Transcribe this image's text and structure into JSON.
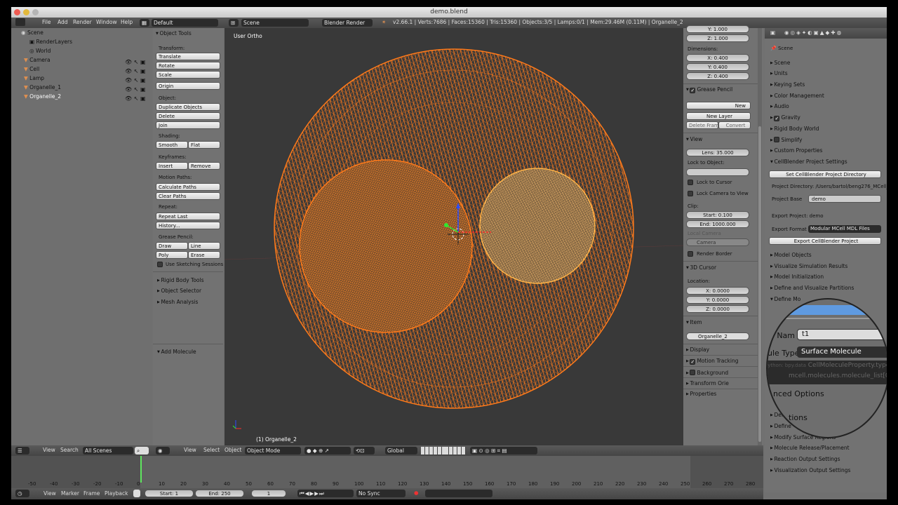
{
  "window": {
    "title": "demo.blend"
  },
  "info_header": {
    "menus": [
      "File",
      "Add",
      "Render",
      "Window",
      "Help"
    ],
    "layout": "Default",
    "scene": "Scene",
    "engine": "Blender Render",
    "stats": "v2.66.1 | Verts:7686 | Faces:15360 | Tris:15360 | Objects:3/5 | Lamps:0/1 | Mem:29.46M (0.11M) | Organelle_2"
  },
  "outliner": {
    "items": [
      "Scene",
      "RenderLayers",
      "World",
      "Camera",
      "Cell",
      "Lamp",
      "Organelle_1",
      "Organelle_2"
    ]
  },
  "tools": {
    "title": "Object Tools",
    "transform_label": "Transform:",
    "translate": "Translate",
    "rotate": "Rotate",
    "scale": "Scale",
    "origin": "Origin",
    "object_label": "Object:",
    "duplicate": "Duplicate Objects",
    "delete": "Delete",
    "join": "Join",
    "shading_label": "Shading:",
    "smooth": "Smooth",
    "flat": "Flat",
    "keyframes_label": "Keyframes:",
    "insert": "Insert",
    "remove": "Remove",
    "motion_label": "Motion Paths:",
    "calc_paths": "Calculate Paths",
    "clear_paths": "Clear Paths",
    "repeat_label": "Repeat:",
    "repeat_last": "Repeat Last",
    "history": "History...",
    "gp_label": "Grease Pencil:",
    "draw": "Draw",
    "line": "Line",
    "poly": "Poly",
    "erase": "Erase",
    "sketch": "Use Sketching Sessions",
    "rigid": "Rigid Body Tools",
    "selector": "Object Selector",
    "mesh_analysis": "Mesh Analysis",
    "add_molecule": "Add Molecule"
  },
  "viewport": {
    "view_name": "User Ortho",
    "object_label": "(1) Organelle_2",
    "colors": {
      "cell": "#ff7a1a",
      "organelle1": "#ff7a1a",
      "organelle2": "#ffb347"
    }
  },
  "view3d_header": {
    "view": "View",
    "select": "Select",
    "object": "Object",
    "mode": "Object Mode",
    "orientation": "Global"
  },
  "npanel": {
    "y": "Y: 1.000",
    "z": "Z: 1.000",
    "dimensions": "Dimensions:",
    "dx": "X: 0.400",
    "dy": "Y: 0.400",
    "dz": "Z: 0.400",
    "grease": "Grease Pencil",
    "new": "New",
    "new_layer": "New Layer",
    "delete_frame": "Delete Frame",
    "convert": "Convert",
    "view": "View",
    "lens": "Lens: 35.000",
    "lock_obj": "Lock to Object:",
    "lock_cursor": "Lock to Cursor",
    "lock_camera": "Lock Camera to View",
    "clip": "Clip:",
    "start": "Start: 0.100",
    "end": "End: 1000.000",
    "local_camera": "Local Camera",
    "camera": "Camera",
    "render_border": "Render Border",
    "cursor3d": "3D Cursor",
    "location": "Location:",
    "cx": "X: 0.0000",
    "cy": "Y: 0.0000",
    "cz": "Z: 0.0000",
    "item": "Item",
    "item_name": "Organelle_2",
    "display": "Display",
    "motion_tracking": "Motion Tracking",
    "background": "Background",
    "transform_orient": "Transform Orie",
    "properties": "Properties"
  },
  "props": {
    "scene_label": "Scene",
    "sections": [
      "Scene",
      "Units",
      "Keying Sets",
      "Color Management",
      "Audio",
      "Gravity",
      "Rigid Body World",
      "Simplify",
      "Custom Properties"
    ],
    "cellblender": "CellBlender Project Settings",
    "set_dir": "Set CellBlender Project Directory",
    "project_dir": "Project Directory: /Users/bartol/beng276_MCell_",
    "project_base_label": "Project Base",
    "project_base": "demo",
    "export_project": "Export Project: demo",
    "export_format_label": "Export Format",
    "export_format": "Modular MCell MDL Files",
    "export_button": "Export CellBlender Project",
    "sections2": [
      "Model Objects",
      "Visualize Simulation Results",
      "Model Initialization",
      "Define and Visualize Partitions"
    ],
    "define_mol": "Define Mo",
    "sections3": [
      "Define",
      "Define",
      "Modify Surface Regions",
      "Molecule Release/Placement",
      "Reaction Output Settings",
      "Visualization Output Settings"
    ]
  },
  "magnifier": {
    "name_label": "le Nam",
    "name_value": "t1",
    "type_label": "ule Type",
    "type_value": "Surface Molecule",
    "tooltip1": "CellMoleculeProperty.type",
    "tooltip2": "mcell.molecules.molecule_list[0]",
    "advanced": "nced Options",
    "tions": "tions",
    "python_prefix": "Python: bpy.data"
  },
  "timeline": {
    "ticks": [
      "-50",
      "-40",
      "-30",
      "-20",
      "-10",
      "0",
      "10",
      "20",
      "30",
      "40",
      "50",
      "60",
      "70",
      "80",
      "90",
      "100",
      "110",
      "120",
      "130",
      "140",
      "150",
      "160",
      "170",
      "180",
      "190",
      "200",
      "210",
      "220",
      "230",
      "240",
      "250",
      "260",
      "270",
      "280"
    ],
    "view": "View",
    "marker": "Marker",
    "frame": "Frame",
    "playback": "Playback",
    "start": "Start: 1",
    "end": "End: 250",
    "current": "1",
    "sync": "No Sync"
  },
  "outliner_header": {
    "view": "View",
    "search": "Search",
    "scenes": "All Scenes"
  }
}
